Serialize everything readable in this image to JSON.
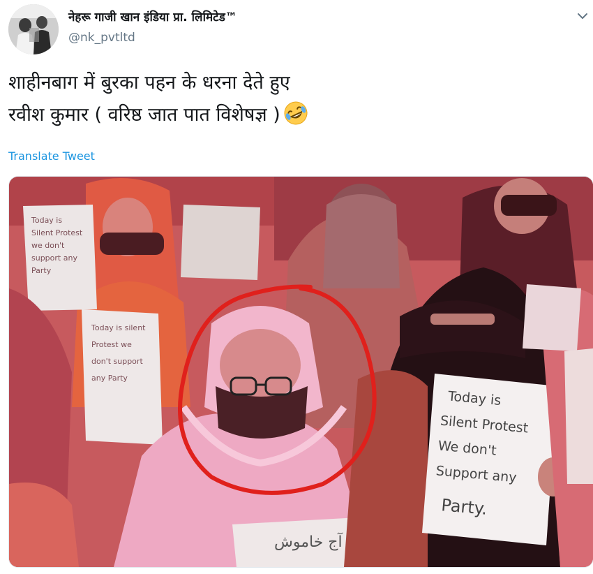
{
  "tweet": {
    "display_name": "नेहरू गाजी खान इंडिया प्रा. लिमिटेड™",
    "handle": "@nk_pvtltd",
    "text_lines": [
      "शाहीनबाग में बुरका पहन के धरना देते हुए",
      "रवीश कुमार ( वरिष्ठ जात पात विशेषज्ञ )"
    ],
    "emoji": "rolling-on-floor-laughing-emoji",
    "translate_label": "Translate Tweet"
  },
  "photo": {
    "placards": {
      "left_small": "Today is Silent Protest we don't support any Party",
      "left_mid": "Today is silent Protest we don't support any Party",
      "right_main_lines": [
        "Today is",
        "Silent Protest",
        "We don't",
        "Support any",
        "Party."
      ],
      "bottom_urdu": "آج خاموش"
    },
    "highlight_color": "#e0201c"
  }
}
